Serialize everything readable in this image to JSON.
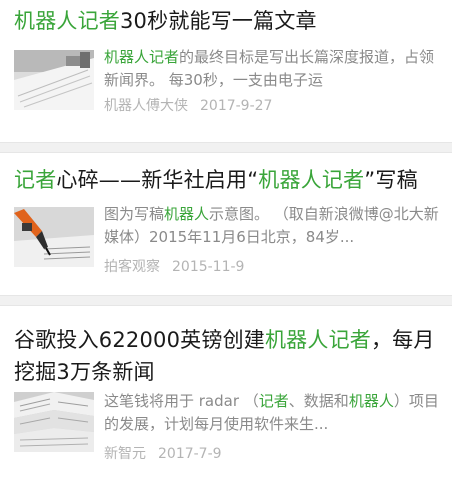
{
  "articles": [
    {
      "title_parts": [
        {
          "text": "机器人记者",
          "hl": true
        },
        {
          "text": "30秒就能写一篇文章",
          "hl": false
        }
      ],
      "summary_parts": [
        {
          "text": "机器人记者",
          "hl": true
        },
        {
          "text": "的最终目标是写出长篇深度报道，占领新闻界。 每30秒，一支由电子运",
          "hl": false
        }
      ],
      "source": "机器人傅大侠",
      "date": "2017-9-27",
      "thumb_icon": "paper-scroll-image"
    },
    {
      "title_parts": [
        {
          "text": "记者",
          "hl": true
        },
        {
          "text": "心碎——新华社启用“",
          "hl": false
        },
        {
          "text": "机器人记者",
          "hl": true
        },
        {
          "text": "”写稿",
          "hl": false
        }
      ],
      "summary_parts": [
        {
          "text": "图为写稿",
          "hl": false
        },
        {
          "text": "机器人",
          "hl": true
        },
        {
          "text": "示意图。 （取自新浪微博@北大新媒体）2015年11月6日北京，84岁...",
          "hl": false
        }
      ],
      "source": "拍客观察",
      "date": "2015-11-9",
      "thumb_icon": "robot-arm-writing-image"
    },
    {
      "title_parts": [
        {
          "text": "谷歌投入622000英镑创建",
          "hl": false
        },
        {
          "text": "机器人记者",
          "hl": true
        },
        {
          "text": "，每月挖掘3万条新闻",
          "hl": false
        }
      ],
      "summary_parts": [
        {
          "text": "这笔钱将用于 radar （",
          "hl": false
        },
        {
          "text": "记者",
          "hl": true
        },
        {
          "text": "、数据和",
          "hl": false
        },
        {
          "text": "机器人",
          "hl": true
        },
        {
          "text": "）项目的发展，计划每月使用软件来生...",
          "hl": false
        }
      ],
      "source": "新智元",
      "date": "2017-7-9",
      "thumb_icon": "newspaper-stack-image"
    }
  ],
  "colors": {
    "highlight": "#3aa53a",
    "title": "#1a1a1a",
    "summary": "#8a8a8a",
    "meta": "#b4b4b4",
    "separator": "#f1f1f1"
  }
}
